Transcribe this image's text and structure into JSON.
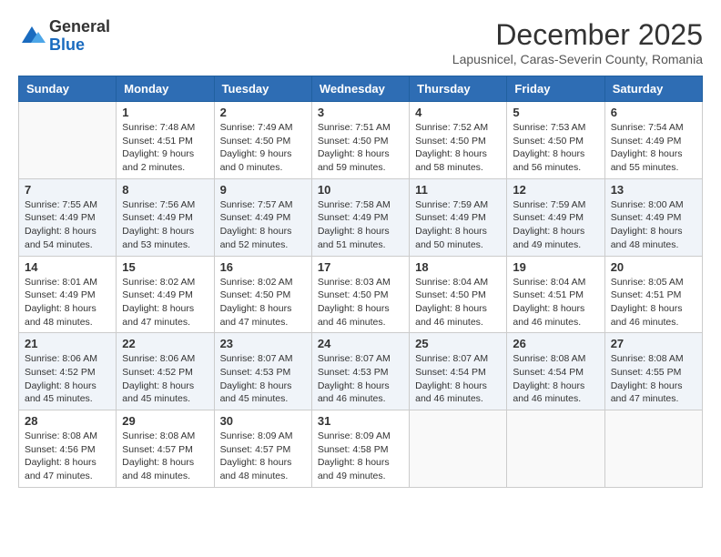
{
  "logo": {
    "general": "General",
    "blue": "Blue"
  },
  "title": "December 2025",
  "location": "Lapusnicel, Caras-Severin County, Romania",
  "days_header": [
    "Sunday",
    "Monday",
    "Tuesday",
    "Wednesday",
    "Thursday",
    "Friday",
    "Saturday"
  ],
  "weeks": [
    [
      {
        "day": "",
        "info": ""
      },
      {
        "day": "1",
        "info": "Sunrise: 7:48 AM\nSunset: 4:51 PM\nDaylight: 9 hours\nand 2 minutes."
      },
      {
        "day": "2",
        "info": "Sunrise: 7:49 AM\nSunset: 4:50 PM\nDaylight: 9 hours\nand 0 minutes."
      },
      {
        "day": "3",
        "info": "Sunrise: 7:51 AM\nSunset: 4:50 PM\nDaylight: 8 hours\nand 59 minutes."
      },
      {
        "day": "4",
        "info": "Sunrise: 7:52 AM\nSunset: 4:50 PM\nDaylight: 8 hours\nand 58 minutes."
      },
      {
        "day": "5",
        "info": "Sunrise: 7:53 AM\nSunset: 4:50 PM\nDaylight: 8 hours\nand 56 minutes."
      },
      {
        "day": "6",
        "info": "Sunrise: 7:54 AM\nSunset: 4:49 PM\nDaylight: 8 hours\nand 55 minutes."
      }
    ],
    [
      {
        "day": "7",
        "info": "Sunrise: 7:55 AM\nSunset: 4:49 PM\nDaylight: 8 hours\nand 54 minutes."
      },
      {
        "day": "8",
        "info": "Sunrise: 7:56 AM\nSunset: 4:49 PM\nDaylight: 8 hours\nand 53 minutes."
      },
      {
        "day": "9",
        "info": "Sunrise: 7:57 AM\nSunset: 4:49 PM\nDaylight: 8 hours\nand 52 minutes."
      },
      {
        "day": "10",
        "info": "Sunrise: 7:58 AM\nSunset: 4:49 PM\nDaylight: 8 hours\nand 51 minutes."
      },
      {
        "day": "11",
        "info": "Sunrise: 7:59 AM\nSunset: 4:49 PM\nDaylight: 8 hours\nand 50 minutes."
      },
      {
        "day": "12",
        "info": "Sunrise: 7:59 AM\nSunset: 4:49 PM\nDaylight: 8 hours\nand 49 minutes."
      },
      {
        "day": "13",
        "info": "Sunrise: 8:00 AM\nSunset: 4:49 PM\nDaylight: 8 hours\nand 48 minutes."
      }
    ],
    [
      {
        "day": "14",
        "info": "Sunrise: 8:01 AM\nSunset: 4:49 PM\nDaylight: 8 hours\nand 48 minutes."
      },
      {
        "day": "15",
        "info": "Sunrise: 8:02 AM\nSunset: 4:49 PM\nDaylight: 8 hours\nand 47 minutes."
      },
      {
        "day": "16",
        "info": "Sunrise: 8:02 AM\nSunset: 4:50 PM\nDaylight: 8 hours\nand 47 minutes."
      },
      {
        "day": "17",
        "info": "Sunrise: 8:03 AM\nSunset: 4:50 PM\nDaylight: 8 hours\nand 46 minutes."
      },
      {
        "day": "18",
        "info": "Sunrise: 8:04 AM\nSunset: 4:50 PM\nDaylight: 8 hours\nand 46 minutes."
      },
      {
        "day": "19",
        "info": "Sunrise: 8:04 AM\nSunset: 4:51 PM\nDaylight: 8 hours\nand 46 minutes."
      },
      {
        "day": "20",
        "info": "Sunrise: 8:05 AM\nSunset: 4:51 PM\nDaylight: 8 hours\nand 46 minutes."
      }
    ],
    [
      {
        "day": "21",
        "info": "Sunrise: 8:06 AM\nSunset: 4:52 PM\nDaylight: 8 hours\nand 45 minutes."
      },
      {
        "day": "22",
        "info": "Sunrise: 8:06 AM\nSunset: 4:52 PM\nDaylight: 8 hours\nand 45 minutes."
      },
      {
        "day": "23",
        "info": "Sunrise: 8:07 AM\nSunset: 4:53 PM\nDaylight: 8 hours\nand 45 minutes."
      },
      {
        "day": "24",
        "info": "Sunrise: 8:07 AM\nSunset: 4:53 PM\nDaylight: 8 hours\nand 46 minutes."
      },
      {
        "day": "25",
        "info": "Sunrise: 8:07 AM\nSunset: 4:54 PM\nDaylight: 8 hours\nand 46 minutes."
      },
      {
        "day": "26",
        "info": "Sunrise: 8:08 AM\nSunset: 4:54 PM\nDaylight: 8 hours\nand 46 minutes."
      },
      {
        "day": "27",
        "info": "Sunrise: 8:08 AM\nSunset: 4:55 PM\nDaylight: 8 hours\nand 47 minutes."
      }
    ],
    [
      {
        "day": "28",
        "info": "Sunrise: 8:08 AM\nSunset: 4:56 PM\nDaylight: 8 hours\nand 47 minutes."
      },
      {
        "day": "29",
        "info": "Sunrise: 8:08 AM\nSunset: 4:57 PM\nDaylight: 8 hours\nand 48 minutes."
      },
      {
        "day": "30",
        "info": "Sunrise: 8:09 AM\nSunset: 4:57 PM\nDaylight: 8 hours\nand 48 minutes."
      },
      {
        "day": "31",
        "info": "Sunrise: 8:09 AM\nSunset: 4:58 PM\nDaylight: 8 hours\nand 49 minutes."
      },
      {
        "day": "",
        "info": ""
      },
      {
        "day": "",
        "info": ""
      },
      {
        "day": "",
        "info": ""
      }
    ]
  ]
}
